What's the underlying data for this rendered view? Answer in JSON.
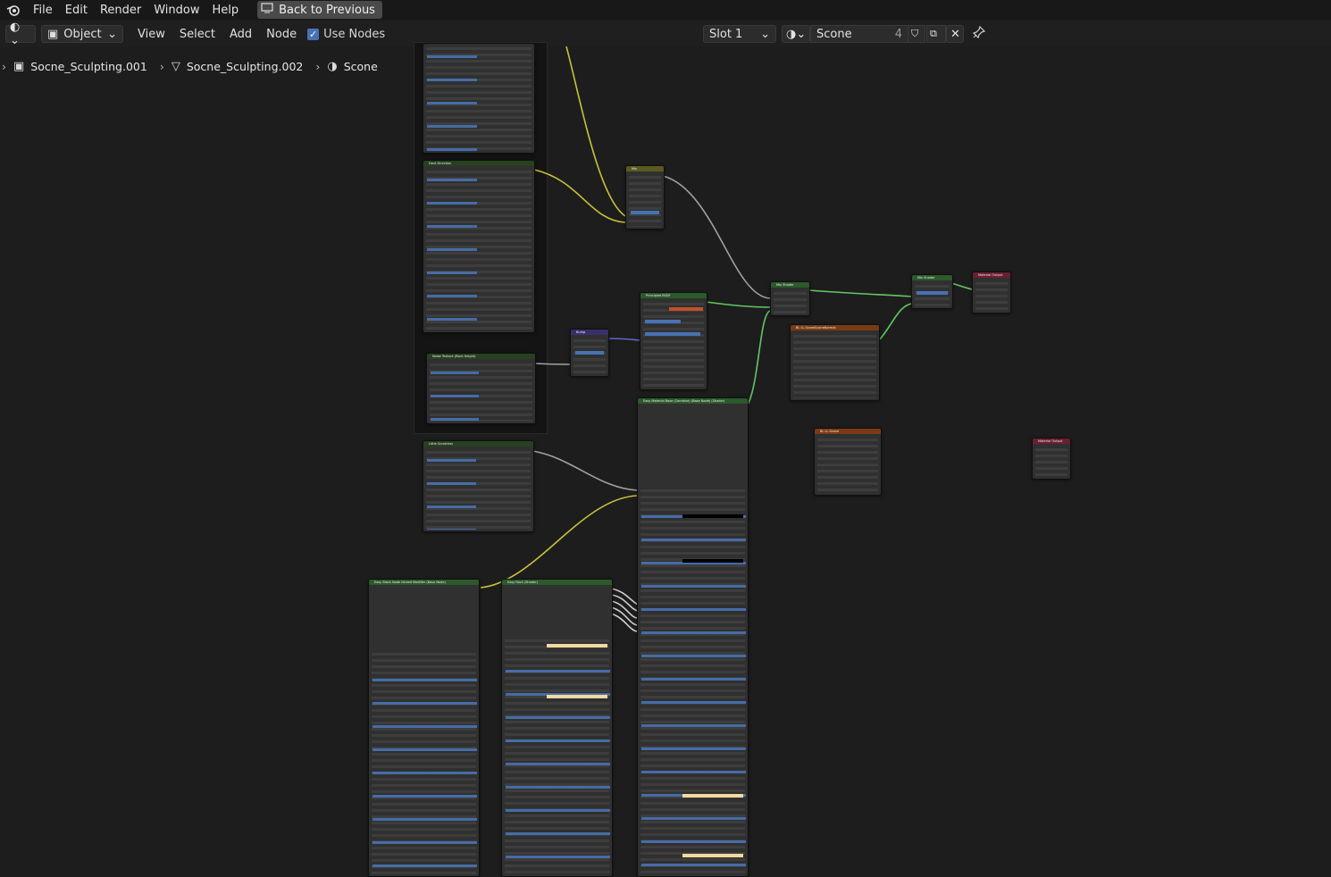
{
  "menubar": {
    "items": [
      "File",
      "Edit",
      "Render",
      "Window",
      "Help"
    ],
    "back_button": "Back to Previous"
  },
  "header": {
    "mode": "Object",
    "menus": [
      "View",
      "Select",
      "Add",
      "Node"
    ],
    "use_nodes_label": "Use Nodes",
    "slot": "Slot 1",
    "material_name": "Scone",
    "user_count": "4"
  },
  "breadcrumb": {
    "items": [
      "Socne_Sculpting.001",
      "Socne_Sculpting.002",
      "Scone"
    ]
  },
  "nodes": {
    "dent_direction": "Dent Direction",
    "mix": "Mix",
    "principled": "Principled BSDF",
    "bump": "Bump",
    "noise_rock_height": "Noise Texture (Rock Height)",
    "little_scratches": "Little Scratches",
    "easy_material_base": "Easy Material Base (Combine) (Base Node) (Shader)",
    "mix_shader_1": "Mix Shader",
    "mix_shader_2": "Mix Shader",
    "material_output_1": "Material Output",
    "material_output_2": "Material Output",
    "normal_tex": "BL LL.SconeSconeNormal",
    "color_tex": "BL LL.Scone",
    "easy_black_node": "Easy Black Node Nicked Modifier (Base Node)",
    "easy_rock": "Easy Rock (Shader)"
  },
  "colors": {
    "accent": "#4772b3",
    "link_yellow": "#c8c23a",
    "link_green": "#63c763",
    "link_grey": "#a1a1a1",
    "link_purple": "#6363c7",
    "base_color_swatch": "#c2502a",
    "cream_swatch": "#f1d9a0"
  }
}
